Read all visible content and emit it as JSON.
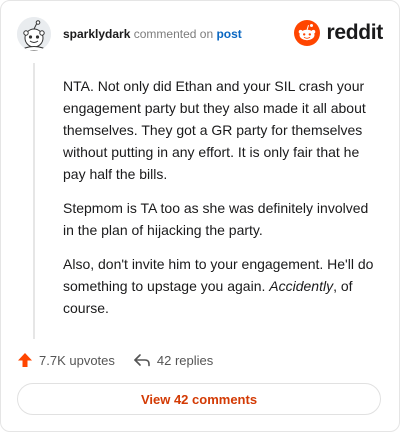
{
  "header": {
    "username": "sparklydark",
    "action_text": "commented on",
    "post_link": "post",
    "brand": "reddit"
  },
  "comment": {
    "p1": "NTA. Not only did Ethan and your SIL crash your engagement party but they also made it all about themselves. They got a GR party for themselves without putting in any effort. It is only fair that he pay half the bills.",
    "p2": "Stepmom is TA too as she was definitely involved in the plan of hijacking the party.",
    "p3_start": "Also, don't invite him to your engagement. He'll do something to upstage you again.",
    "p3_italic": "Accidently",
    "p3_end": ", of course."
  },
  "actions": {
    "upvotes": "7.7K upvotes",
    "replies": "42 replies"
  },
  "view_button": "View 42 comments",
  "colors": {
    "reddit_orange": "#ff4500",
    "link_blue": "#0a67c2",
    "button_text": "#d33a04"
  },
  "icons": [
    "avatar-snoo",
    "reddit-logo-icon",
    "upvote-arrow-icon",
    "reply-icon"
  ]
}
